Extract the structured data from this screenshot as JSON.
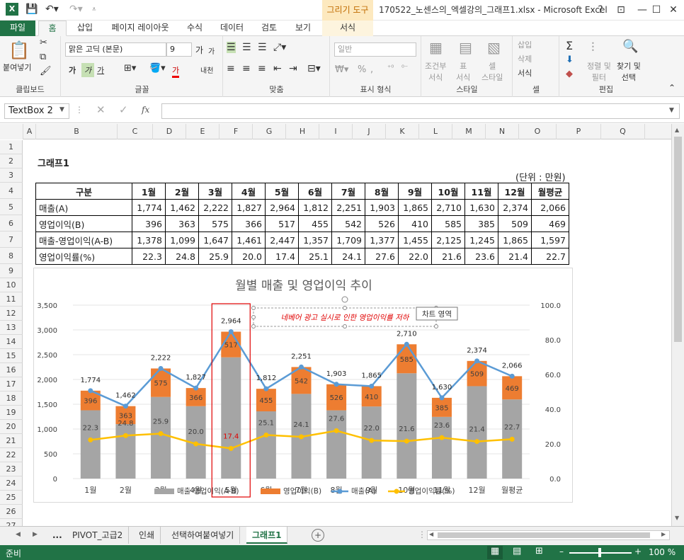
{
  "titlebar": {
    "context_tab": "그리기 도구",
    "title": "170522_노센스의_엑셀강의_그래프1.xlsx - Microsoft Excel",
    "help": "?",
    "restore_ribbon": "⊡",
    "minimize": "—",
    "maximize": "☐",
    "close": "✕"
  },
  "tabs": {
    "file": "파일",
    "home": "홈",
    "insert": "삽입",
    "page_layout": "페이지 레이아웃",
    "formulas": "수식",
    "data": "데이터",
    "review": "검토",
    "view": "보기",
    "format": "서식"
  },
  "ribbon": {
    "clipboard": {
      "paste": "붙여넣기",
      "label": "클립보드"
    },
    "font": {
      "name": "맑은 고딕 (본문)",
      "size": "9",
      "grow": "가",
      "shrink": "가",
      "bold": "가",
      "italic": "가",
      "underline": "가",
      "font_color": "가",
      "phonetic": "내천",
      "label": "글꼴"
    },
    "alignment": {
      "label": "맞춤"
    },
    "number": {
      "format": "일반",
      "percent": "%",
      "comma": ",",
      "label": "표시 형식"
    },
    "styles": {
      "conditional": "조건부\n서식",
      "table": "표\n서식",
      "cell_style": "셀\n스타일",
      "label": "스타일"
    },
    "cells": {
      "insert": "삽입",
      "delete": "삭제",
      "format": "서식",
      "label": "셀"
    },
    "editing": {
      "sum": "Σ",
      "sort": "정렬 및\n필터",
      "find": "찾기 및\n선택",
      "label": "편집"
    }
  },
  "formula_bar": {
    "name_box": "TextBox 2",
    "fx": "fx",
    "value": ""
  },
  "columns": [
    "A",
    "B",
    "C",
    "D",
    "E",
    "F",
    "G",
    "H",
    "I",
    "J",
    "K",
    "L",
    "M",
    "N",
    "O",
    "P",
    "Q"
  ],
  "rows": [
    "1",
    "2",
    "3",
    "4",
    "5",
    "6",
    "7",
    "8",
    "9",
    "10",
    "11",
    "12",
    "13",
    "14",
    "15",
    "16",
    "17",
    "18",
    "19",
    "20",
    "21",
    "22",
    "23",
    "24",
    "25",
    "26",
    "27"
  ],
  "sheet": {
    "title": "그래프1",
    "unit": "(단위 : 만원)",
    "headers": [
      "구분",
      "1월",
      "2월",
      "3월",
      "4월",
      "5월",
      "6월",
      "7월",
      "8월",
      "9월",
      "10월",
      "11월",
      "12월",
      "월평균"
    ],
    "table_rows": [
      {
        "label": "매출(A)",
        "values": [
          "1,774",
          "1,462",
          "2,222",
          "1,827",
          "2,964",
          "1,812",
          "2,251",
          "1,903",
          "1,865",
          "2,710",
          "1,630",
          "2,374",
          "2,066"
        ]
      },
      {
        "label": "영업이익(B)",
        "values": [
          "396",
          "363",
          "575",
          "366",
          "517",
          "455",
          "542",
          "526",
          "410",
          "585",
          "385",
          "509",
          "469"
        ]
      },
      {
        "label": "매출-영업이익(A-B)",
        "values": [
          "1,378",
          "1,099",
          "1,647",
          "1,461",
          "2,447",
          "1,357",
          "1,709",
          "1,377",
          "1,455",
          "2,125",
          "1,245",
          "1,865",
          "1,597"
        ]
      },
      {
        "label": "영업이익률(%)",
        "values": [
          "22.3",
          "24.8",
          "25.9",
          "20.0",
          "17.4",
          "25.1",
          "24.1",
          "27.6",
          "22.0",
          "21.6",
          "23.6",
          "21.4",
          "22.7"
        ]
      }
    ]
  },
  "chart_data": {
    "type": "bar",
    "title": "월별 매출 및 영업이익 추이",
    "categories": [
      "1월",
      "2월",
      "3월",
      "4월",
      "5월",
      "6월",
      "7월",
      "8월",
      "9월",
      "10월",
      "11월",
      "12월",
      "월평균"
    ],
    "ylim": [
      0,
      3500
    ],
    "y_ticks": [
      "0",
      "500",
      "1,000",
      "1,500",
      "2,000",
      "2,500",
      "3,000",
      "3,500"
    ],
    "y2lim": [
      0,
      100
    ],
    "y2_ticks": [
      "0.0",
      "20.0",
      "40.0",
      "60.0",
      "80.0",
      "100.0"
    ],
    "stacked": true,
    "series": [
      {
        "name": "매출-영업이익(A-B)",
        "kind": "bar",
        "axis": "left",
        "color": "#a5a5a5",
        "values": [
          1378,
          1099,
          1647,
          1461,
          2447,
          1357,
          1709,
          1377,
          1455,
          2125,
          1245,
          1865,
          1597
        ]
      },
      {
        "name": "영업이익(B)",
        "kind": "bar",
        "axis": "left",
        "color": "#ed7d31",
        "values": [
          396,
          363,
          575,
          366,
          517,
          455,
          542,
          526,
          410,
          585,
          385,
          509,
          469
        ]
      },
      {
        "name": "매출(A)",
        "kind": "line",
        "axis": "left",
        "color": "#5b9bd5",
        "values": [
          1774,
          1462,
          2222,
          1827,
          2964,
          1812,
          2251,
          1903,
          1865,
          2710,
          1630,
          2374,
          2066
        ]
      },
      {
        "name": "영업이익률(%)",
        "kind": "line",
        "axis": "right",
        "color": "#ffc000",
        "values": [
          22.3,
          24.8,
          25.9,
          20.0,
          17.4,
          25.1,
          24.1,
          27.6,
          22.0,
          21.6,
          23.6,
          21.4,
          22.7
        ]
      }
    ],
    "sales_labels": [
      "1,774",
      "1,462",
      "2,222",
      "1,827",
      "2,964",
      "1,812",
      "2,251",
      "1,903",
      "1,865",
      "2,710",
      "1,630",
      "2,374",
      "2,066"
    ],
    "profit_labels": [
      "396",
      "363",
      "575",
      "366",
      "517",
      "455",
      "542",
      "526",
      "410",
      "585",
      "385",
      "509",
      "469"
    ],
    "rate_labels": [
      "22.3",
      "24.8",
      "25.9",
      "20.0",
      "17.4",
      "25.1",
      "24.1",
      "27.6",
      "22.0",
      "21.6",
      "23.6",
      "21.4",
      "22.7"
    ],
    "annotation": "네베어 광고 실시로 인한 영업이익률 저하",
    "highlight_index": 4,
    "highlight_color": "#e00000",
    "tooltip": "차트 영역",
    "legend_position": "bottom"
  },
  "sheet_tabs": {
    "more": "...",
    "tabs": [
      "PIVOT_고급2",
      "인쇄",
      "선택하여붙여넣기",
      "그래프1"
    ],
    "add": "+"
  },
  "status": {
    "ready": "준비",
    "zoom": "100 %"
  }
}
